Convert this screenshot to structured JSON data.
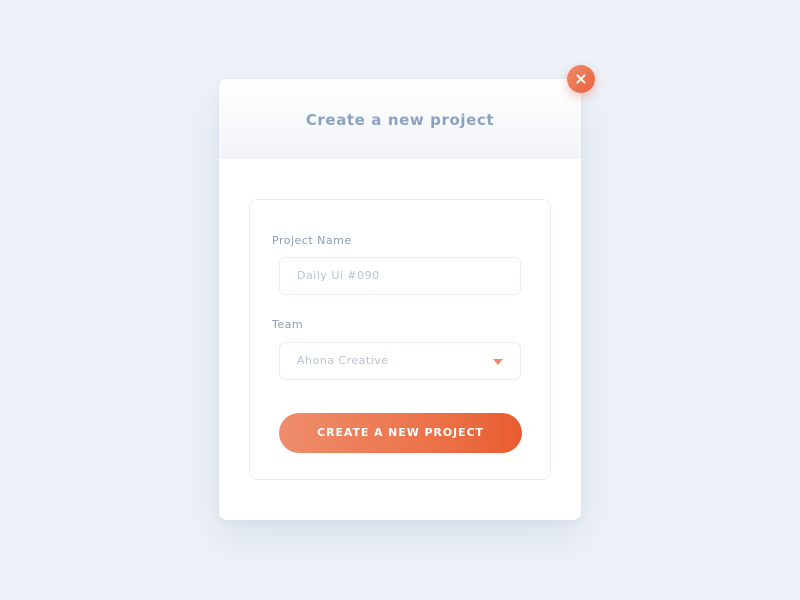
{
  "modal": {
    "title": "Create a new project"
  },
  "close_button": {
    "label": "×"
  },
  "form": {
    "project_name_label": "Project Name",
    "project_name_placeholder": "Daily Ui #090",
    "team_label": "Team",
    "team_selected": "Ahona Creative",
    "submit_label": "CREATE A NEW PROJECT"
  },
  "colors": {
    "accent": "#e8623b",
    "accent_light": "#ee8d6c",
    "text_muted": "#8ca2c0"
  },
  "icons": {
    "close": "close-icon",
    "caret": "chevron-down-icon"
  }
}
